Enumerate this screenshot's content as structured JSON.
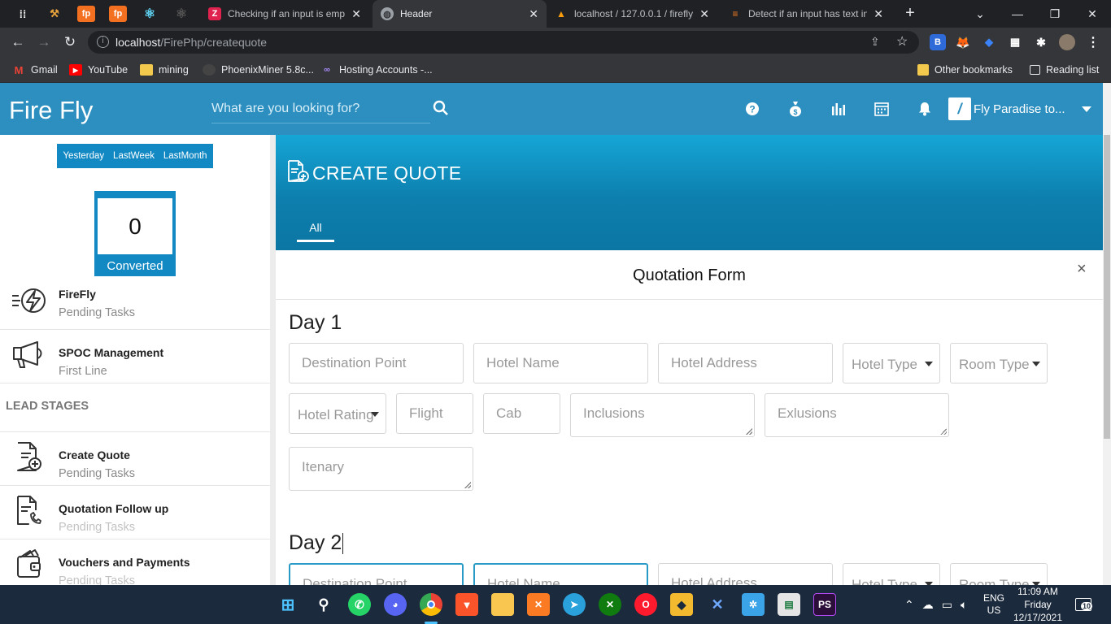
{
  "browser": {
    "tabs": [
      {
        "title": "Checking if an input is empt",
        "favicon": "Z"
      },
      {
        "title": "Header",
        "favicon": "globe"
      },
      {
        "title": "localhost / 127.0.0.1 / firefly",
        "favicon": "pma"
      },
      {
        "title": "Detect if an input has text in",
        "favicon": "so"
      }
    ],
    "url_host": "localhost",
    "url_path": "/FirePhp/createquote",
    "bookmarks": [
      "Gmail",
      "YouTube",
      "mining",
      "PhoenixMiner 5.8c...",
      "Hosting Accounts -..."
    ],
    "other_bookmarks": "Other bookmarks",
    "reading_list": "Reading list"
  },
  "header": {
    "brand": "Fire Fly",
    "search_placeholder": "What are you looking for?",
    "company": "Fly Paradise to..."
  },
  "sidebar": {
    "date_filters": [
      "Yesterday",
      "LastWeek",
      "LastMonth"
    ],
    "converted_count": "0",
    "converted_label": "Converted",
    "items": [
      {
        "title": "FireFly",
        "subtitle": "Pending Tasks"
      },
      {
        "title": "SPOC Management",
        "subtitle": "First Line"
      }
    ],
    "section_heading": "LEAD STAGES",
    "stages": [
      {
        "title": "Create Quote",
        "subtitle": "Pending Tasks"
      },
      {
        "title": "Quotation Follow up",
        "subtitle": "Pending Tasks"
      },
      {
        "title": "Vouchers and Payments",
        "subtitle": "Pending Tasks"
      }
    ]
  },
  "main": {
    "page_title": "CREATE QUOTE",
    "tab": "All",
    "form_title": "Quotation Form",
    "close_symbol": "×",
    "day1_label": "Day 1",
    "day2_label": "Day 2",
    "fields": {
      "destination": "Destination Point",
      "hotel_name": "Hotel Name",
      "hotel_address": "Hotel Address",
      "hotel_type": "Hotel Type",
      "room_type": "Room Type",
      "hotel_rating": "Hotel Rating",
      "flight": "Flight",
      "cab": "Cab",
      "inclusions": "Inclusions",
      "exclusions": "Exlusions",
      "itinerary": "Itenary"
    }
  },
  "taskbar": {
    "language": "ENG",
    "region": "US",
    "time": "11:09 AM",
    "day": "Friday",
    "date": "12/17/2021",
    "notifications": "10"
  }
}
